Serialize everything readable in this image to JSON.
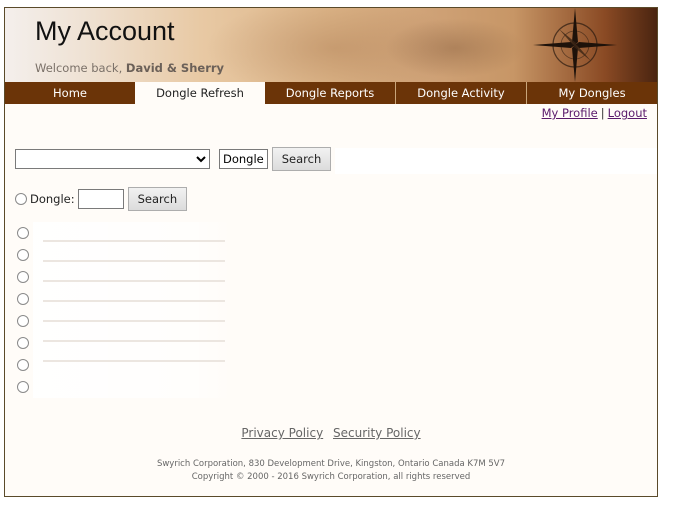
{
  "header": {
    "title": "My Account",
    "welcome_prefix": "Welcome back, ",
    "user_name": "David & Sherry"
  },
  "nav": {
    "tabs": [
      {
        "label": "Home",
        "active": false
      },
      {
        "label": "Dongle Refresh",
        "active": true
      },
      {
        "label": "Dongle Reports",
        "active": false
      },
      {
        "label": "Dongle Activity",
        "active": false
      },
      {
        "label": "My Dongles",
        "active": false
      }
    ]
  },
  "user_links": {
    "profile": "My Profile",
    "separator": "|",
    "logout": "Logout"
  },
  "search_row": {
    "select_value": "",
    "type_chip": "Dongle",
    "search_label": "Search"
  },
  "dongle_row": {
    "label": "Dongle:",
    "input_value": "",
    "search_label": "Search"
  },
  "options_count": 8,
  "footer": {
    "privacy": "Privacy Policy",
    "security": "Security Policy",
    "address": "Swyrich Corporation, 830 Development Drive, Kingston, Ontario Canada K7M 5V7",
    "copyright": "Copyright © 2000 - 2016 Swyrich Corporation, all rights reserved"
  },
  "colors": {
    "nav_bg": "#6b3408",
    "page_bg": "#fffcf8",
    "link": "#5a1a6b"
  }
}
